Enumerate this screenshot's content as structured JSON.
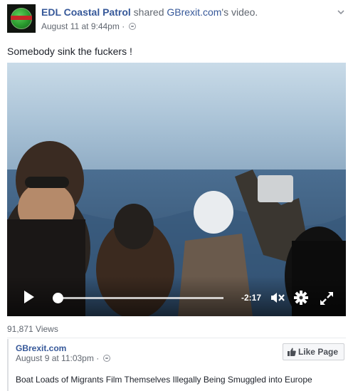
{
  "post": {
    "author": "EDL Coastal Patrol",
    "action_text": " shared ",
    "shared_source": "GBrexit.com",
    "shared_suffix": "'s video.",
    "timestamp": "August 11 at 9:44pm",
    "separator": " · ",
    "text": "Somebody sink the fuckers !"
  },
  "video": {
    "time_remaining": "-2:17",
    "progress": 0.03,
    "views": "91,871 Views"
  },
  "shared_page": {
    "name": "GBrexit.com",
    "timestamp": "August 9 at 11:03pm",
    "separator": " · ",
    "like_button": "Like Page",
    "video_title": "Boat Loads of Migrants Film Themselves Illegally Being Smuggled into Europe"
  },
  "colors": {
    "link": "#365899",
    "muted": "#616770",
    "text": "#1d2129"
  },
  "icons": {
    "avatar": "edl-globe-logo",
    "privacy": "globe-icon",
    "menu": "chevron-down-icon",
    "play": "play-icon",
    "mute": "mute-icon",
    "settings": "gear-icon",
    "fullscreen": "fullscreen-icon",
    "like": "thumbs-up-icon"
  }
}
